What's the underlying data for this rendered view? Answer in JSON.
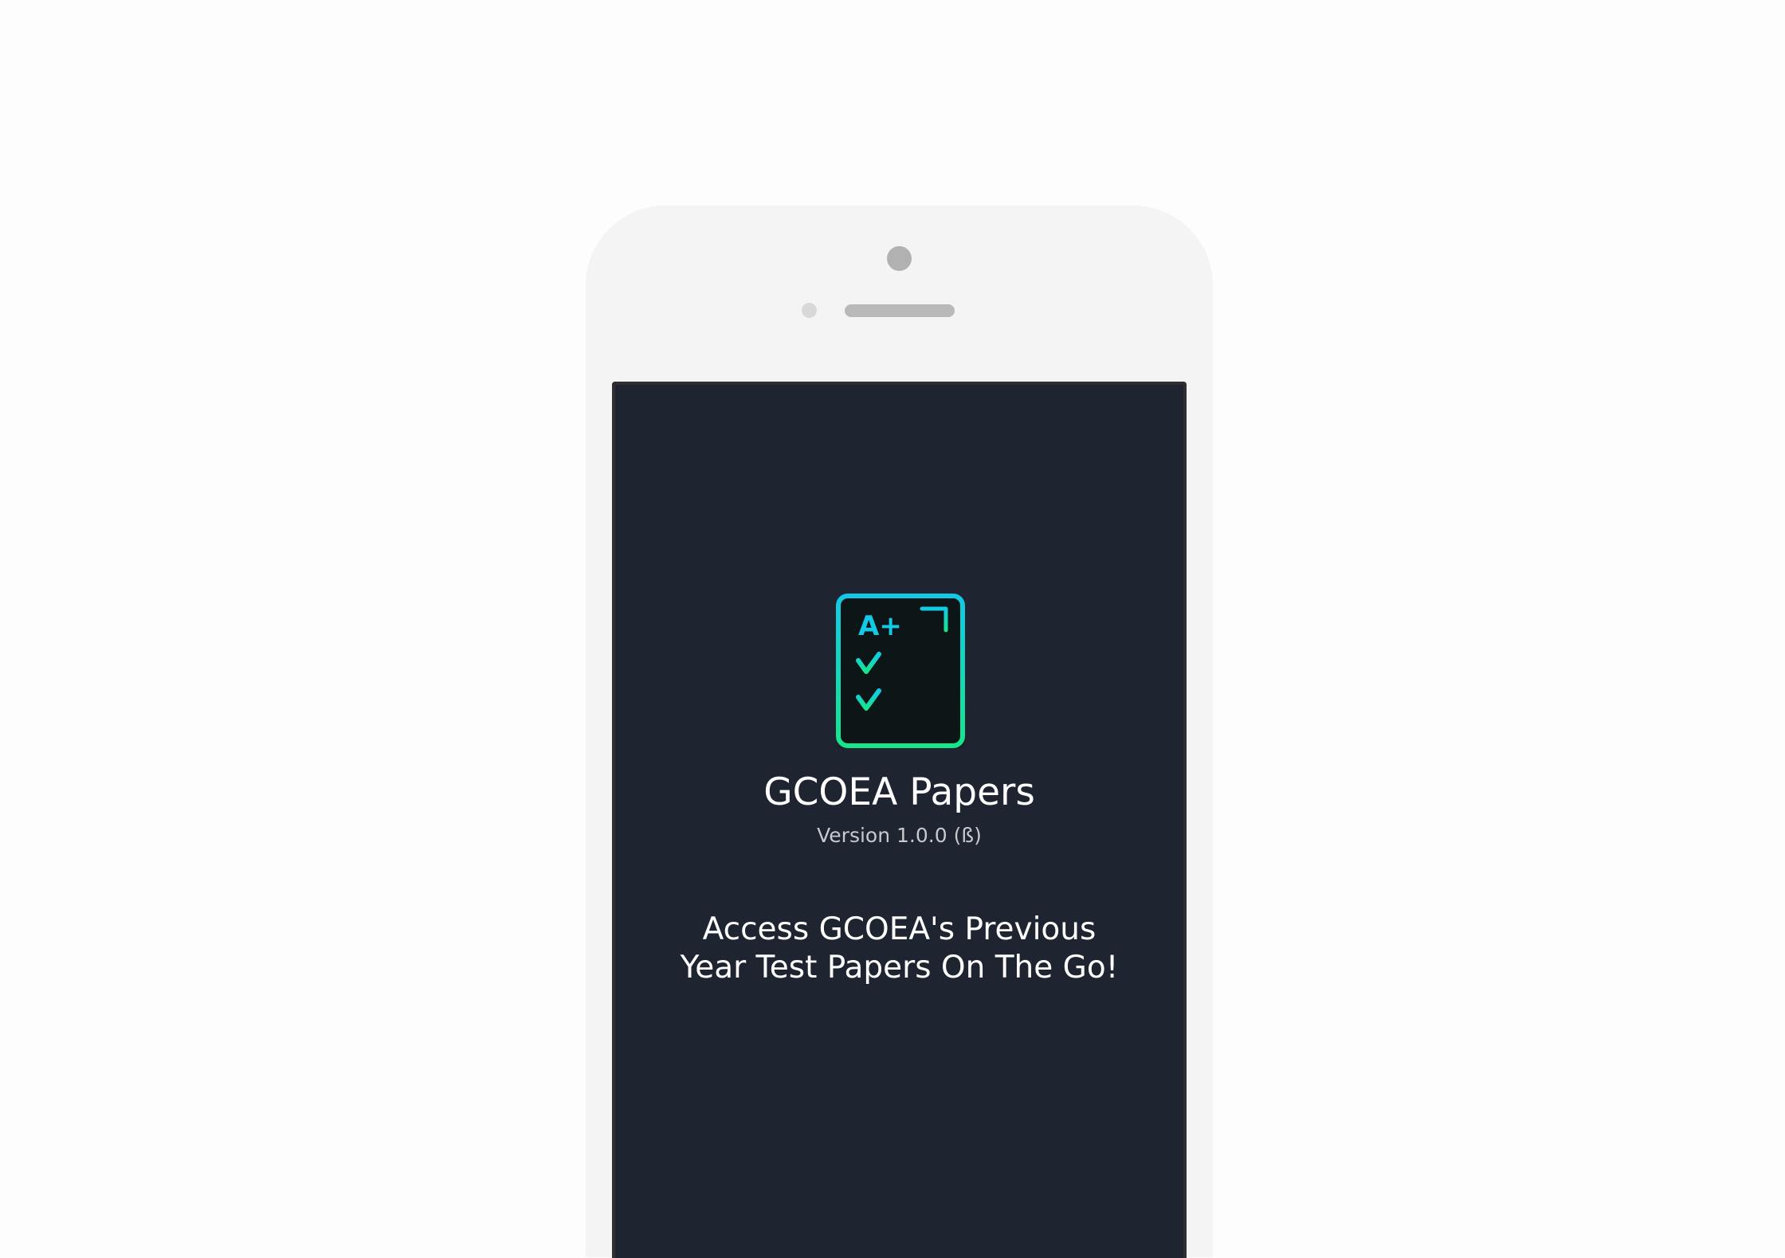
{
  "app": {
    "title": "GCOEA Papers",
    "version": "Version 1.0.0 (ß)",
    "tagline_line1": "Access GCOEA's Previous",
    "tagline_line2": "Year Test Papers On The Go!",
    "logo_grade": "A+",
    "logo_icon": "checklist-document-icon"
  },
  "colors": {
    "screen_background": "#1e2430",
    "logo_gradient_start": "#13c9e6",
    "logo_gradient_end": "#17e58c",
    "phone_body": "#f4f4f4"
  }
}
